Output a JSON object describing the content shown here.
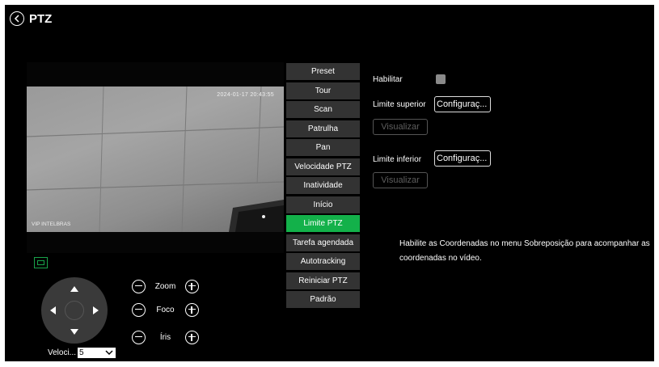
{
  "header": {
    "title": "PTZ",
    "back_icon": "back-circle-icon"
  },
  "video": {
    "timestamp": "2024-01-17 20:43:55",
    "watermark": "VIP INTELBRAS"
  },
  "controls": {
    "fit_icon": "fit-screen-icon",
    "zoom_label": "Zoom",
    "focus_label": "Foco",
    "iris_label": "Íris",
    "speed_label": "Veloci...",
    "speed_value": "5"
  },
  "menu": {
    "items": [
      {
        "label": "Preset",
        "active": false
      },
      {
        "label": "Tour",
        "active": false
      },
      {
        "label": "Scan",
        "active": false
      },
      {
        "label": "Patrulha",
        "active": false
      },
      {
        "label": "Pan",
        "active": false
      },
      {
        "label": "Velocidade PTZ",
        "active": false
      },
      {
        "label": "Inatividade",
        "active": false
      },
      {
        "label": "Início",
        "active": false
      },
      {
        "label": "Limite PTZ",
        "active": true
      },
      {
        "label": "Tarefa agendada",
        "active": false
      },
      {
        "label": "Autotracking",
        "active": false
      },
      {
        "label": "Reiniciar PTZ",
        "active": false
      },
      {
        "label": "Padrão",
        "active": false
      }
    ]
  },
  "panel": {
    "enable_label": "Habilitar",
    "enable_checked": false,
    "upper_label": "Limite superior",
    "upper_button": "Configuraç...",
    "upper_view": "Visualizar",
    "lower_label": "Limite inferior",
    "lower_button": "Configuraç...",
    "lower_view": "Visualizar",
    "hint": "Habilite as Coordenadas no menu Sobreposição para acompanhar as coordenadas no vídeo."
  },
  "colors": {
    "accent": "#13b14a",
    "background": "#000000",
    "menu_bg": "#333333"
  }
}
